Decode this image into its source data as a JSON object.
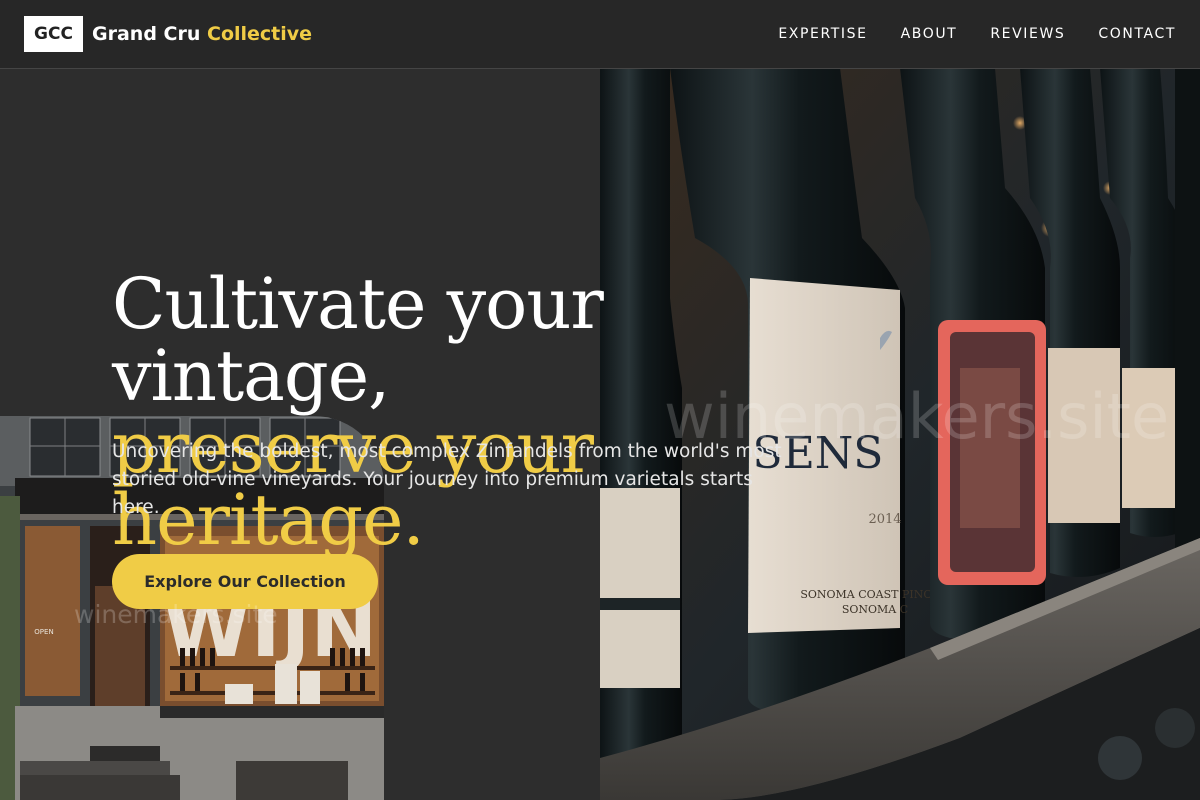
{
  "brand": {
    "logo_text": "GCC",
    "name_main": "Grand Cru",
    "name_accent": "Collective"
  },
  "nav": {
    "items": [
      {
        "label": "EXPERTISE"
      },
      {
        "label": "ABOUT"
      },
      {
        "label": "REVIEWS"
      },
      {
        "label": "CONTACT"
      }
    ]
  },
  "hero": {
    "headline_line1": "Cultivate your vintage,",
    "headline_line2": "preserve your heritage.",
    "subtext": "Uncovering the boldest, most complex Zinfandels from the world's most storied old-vine vineyards. Your journey into premium varietals starts here.",
    "cta_label": "Explore Our Collection"
  },
  "images": {
    "bottles_photo": {
      "label_brand": "SENS",
      "label_year": "2014",
      "label_region1": "SONOMA COAST",
      "label_region2": "SONOMA C"
    },
    "shop_photo": {
      "shop_sign": "WIJN",
      "door_sign": "OPEN"
    }
  },
  "watermarks": [
    "winemakers.site",
    "winemakers.site"
  ],
  "colors": {
    "accent": "#f0cc46",
    "background": "#2d2d2d",
    "topbar": "#282828"
  }
}
